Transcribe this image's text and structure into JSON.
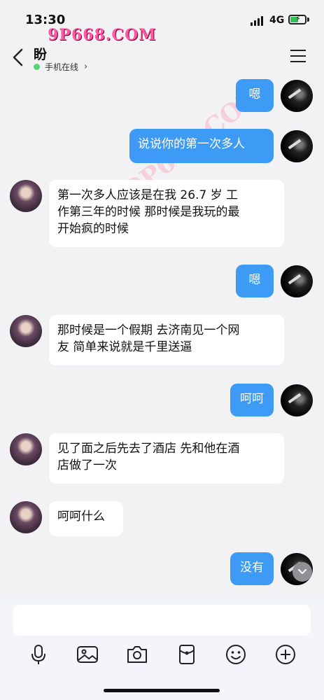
{
  "status_bar": {
    "time": "13:30",
    "network": "4G",
    "battery_level": 0.55
  },
  "watermark": {
    "text": "9P668.COM"
  },
  "header": {
    "contact_name": "盼",
    "online_status": "手机在线"
  },
  "messages": [
    {
      "from": "me",
      "text": "嗯"
    },
    {
      "from": "me",
      "text": "说说你的第一次多人"
    },
    {
      "from": "her",
      "lines": [
        "第一次多人应该是在我 26.7 岁 工",
        "作第三年的时候 那时候是我玩的最",
        "开始疯的时候"
      ]
    },
    {
      "from": "me",
      "text": "嗯"
    },
    {
      "from": "her",
      "lines": [
        "那时候是一个假期 去济南见一个网",
        "友 简单来说就是千里送逼"
      ]
    },
    {
      "from": "me",
      "text": "呵呵"
    },
    {
      "from": "her",
      "lines": [
        "见了面之后先去了酒店 先和他在酒",
        "店做了一次"
      ]
    },
    {
      "from": "her",
      "text": "呵呵什么"
    },
    {
      "from": "me",
      "text": "没有"
    }
  ],
  "toolbar": {
    "icons": [
      "microphone-icon",
      "image-icon",
      "camera-icon",
      "red-packet-icon",
      "emoji-icon",
      "plus-icon"
    ]
  }
}
